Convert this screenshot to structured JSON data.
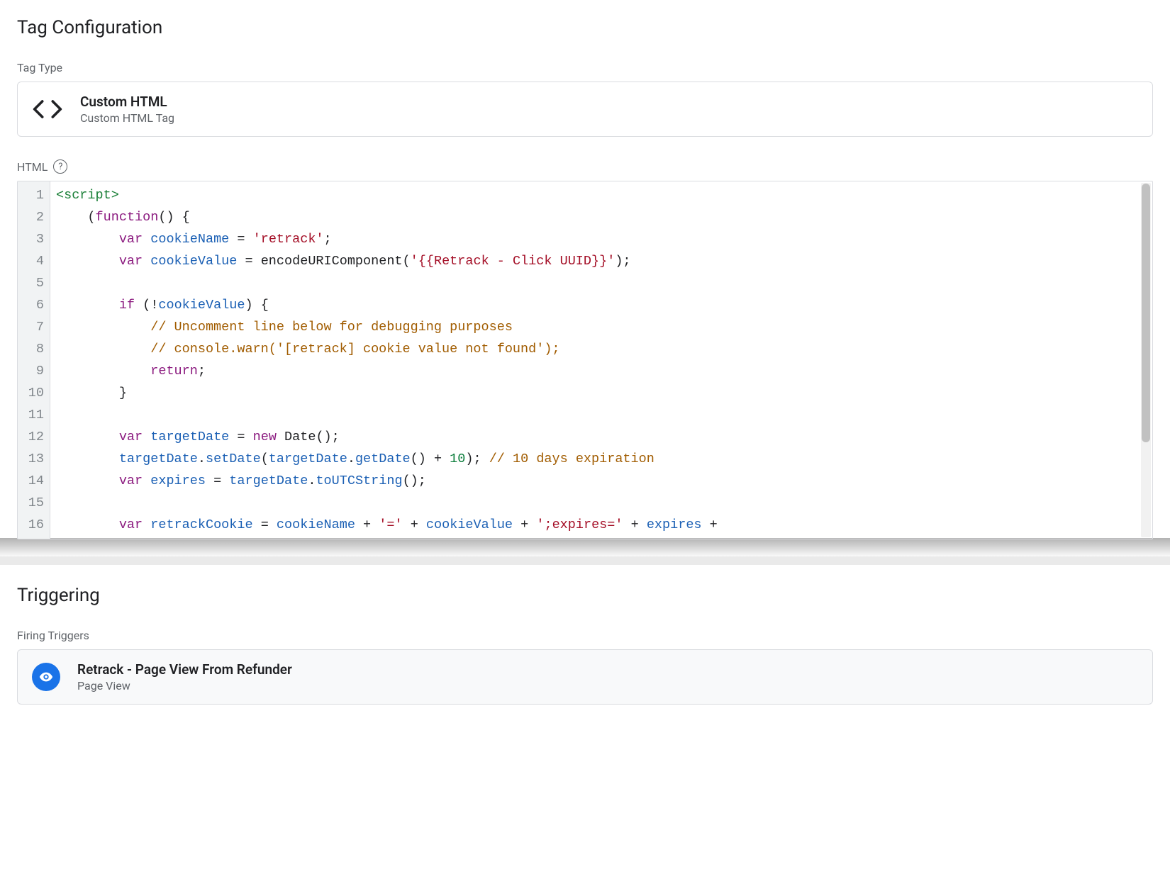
{
  "tagConfig": {
    "heading": "Tag Configuration",
    "tagTypeLabel": "Tag Type",
    "tagType": {
      "title": "Custom HTML",
      "subtitle": "Custom HTML Tag"
    },
    "htmlLabel": "HTML"
  },
  "code": {
    "lineCount": 16,
    "tokens": [
      [
        {
          "t": "tag",
          "v": "<script>"
        }
      ],
      [
        {
          "t": "sp",
          "v": "    "
        },
        {
          "t": "op",
          "v": "("
        },
        {
          "t": "kw",
          "v": "function"
        },
        {
          "t": "op",
          "v": "() {"
        }
      ],
      [
        {
          "t": "sp",
          "v": "        "
        },
        {
          "t": "kw",
          "v": "var"
        },
        {
          "t": "sp",
          "v": " "
        },
        {
          "t": "var",
          "v": "cookieName"
        },
        {
          "t": "sp",
          "v": " "
        },
        {
          "t": "op",
          "v": "="
        },
        {
          "t": "sp",
          "v": " "
        },
        {
          "t": "str",
          "v": "'retrack'"
        },
        {
          "t": "op",
          "v": ";"
        }
      ],
      [
        {
          "t": "sp",
          "v": "        "
        },
        {
          "t": "kw",
          "v": "var"
        },
        {
          "t": "sp",
          "v": " "
        },
        {
          "t": "var",
          "v": "cookieValue"
        },
        {
          "t": "sp",
          "v": " "
        },
        {
          "t": "op",
          "v": "="
        },
        {
          "t": "sp",
          "v": " "
        },
        {
          "t": "id",
          "v": "encodeURIComponent"
        },
        {
          "t": "op",
          "v": "("
        },
        {
          "t": "str",
          "v": "'{{Retrack - Click UUID}}'"
        },
        {
          "t": "op",
          "v": ");"
        }
      ],
      [],
      [
        {
          "t": "sp",
          "v": "        "
        },
        {
          "t": "kw",
          "v": "if"
        },
        {
          "t": "sp",
          "v": " "
        },
        {
          "t": "op",
          "v": "(!"
        },
        {
          "t": "var",
          "v": "cookieValue"
        },
        {
          "t": "op",
          "v": ") {"
        }
      ],
      [
        {
          "t": "sp",
          "v": "            "
        },
        {
          "t": "com",
          "v": "// Uncomment line below for debugging purposes"
        }
      ],
      [
        {
          "t": "sp",
          "v": "            "
        },
        {
          "t": "com",
          "v": "// console.warn('[retrack] cookie value not found');"
        }
      ],
      [
        {
          "t": "sp",
          "v": "            "
        },
        {
          "t": "kw",
          "v": "return"
        },
        {
          "t": "op",
          "v": ";"
        }
      ],
      [
        {
          "t": "sp",
          "v": "        "
        },
        {
          "t": "op",
          "v": "}"
        }
      ],
      [],
      [
        {
          "t": "sp",
          "v": "        "
        },
        {
          "t": "kw",
          "v": "var"
        },
        {
          "t": "sp",
          "v": " "
        },
        {
          "t": "var",
          "v": "targetDate"
        },
        {
          "t": "sp",
          "v": " "
        },
        {
          "t": "op",
          "v": "="
        },
        {
          "t": "sp",
          "v": " "
        },
        {
          "t": "kw",
          "v": "new"
        },
        {
          "t": "sp",
          "v": " "
        },
        {
          "t": "id",
          "v": "Date"
        },
        {
          "t": "op",
          "v": "();"
        }
      ],
      [
        {
          "t": "sp",
          "v": "        "
        },
        {
          "t": "var",
          "v": "targetDate"
        },
        {
          "t": "op",
          "v": "."
        },
        {
          "t": "fn",
          "v": "setDate"
        },
        {
          "t": "op",
          "v": "("
        },
        {
          "t": "var",
          "v": "targetDate"
        },
        {
          "t": "op",
          "v": "."
        },
        {
          "t": "fn",
          "v": "getDate"
        },
        {
          "t": "op",
          "v": "() + "
        },
        {
          "t": "num",
          "v": "10"
        },
        {
          "t": "op",
          "v": "); "
        },
        {
          "t": "com",
          "v": "// 10 days expiration"
        }
      ],
      [
        {
          "t": "sp",
          "v": "        "
        },
        {
          "t": "kw",
          "v": "var"
        },
        {
          "t": "sp",
          "v": " "
        },
        {
          "t": "var",
          "v": "expires"
        },
        {
          "t": "sp",
          "v": " "
        },
        {
          "t": "op",
          "v": "="
        },
        {
          "t": "sp",
          "v": " "
        },
        {
          "t": "var",
          "v": "targetDate"
        },
        {
          "t": "op",
          "v": "."
        },
        {
          "t": "fn",
          "v": "toUTCString"
        },
        {
          "t": "op",
          "v": "();"
        }
      ],
      [],
      [
        {
          "t": "sp",
          "v": "        "
        },
        {
          "t": "kw",
          "v": "var"
        },
        {
          "t": "sp",
          "v": " "
        },
        {
          "t": "var",
          "v": "retrackCookie"
        },
        {
          "t": "sp",
          "v": " "
        },
        {
          "t": "op",
          "v": "="
        },
        {
          "t": "sp",
          "v": " "
        },
        {
          "t": "var",
          "v": "cookieName"
        },
        {
          "t": "sp",
          "v": " "
        },
        {
          "t": "op",
          "v": "+"
        },
        {
          "t": "sp",
          "v": " "
        },
        {
          "t": "str",
          "v": "'='"
        },
        {
          "t": "sp",
          "v": " "
        },
        {
          "t": "op",
          "v": "+"
        },
        {
          "t": "sp",
          "v": " "
        },
        {
          "t": "var",
          "v": "cookieValue"
        },
        {
          "t": "sp",
          "v": " "
        },
        {
          "t": "op",
          "v": "+"
        },
        {
          "t": "sp",
          "v": " "
        },
        {
          "t": "str",
          "v": "';expires='"
        },
        {
          "t": "sp",
          "v": " "
        },
        {
          "t": "op",
          "v": "+"
        },
        {
          "t": "sp",
          "v": " "
        },
        {
          "t": "var",
          "v": "expires"
        },
        {
          "t": "sp",
          "v": " "
        },
        {
          "t": "op",
          "v": "+"
        }
      ]
    ]
  },
  "triggering": {
    "heading": "Triggering",
    "firingLabel": "Firing Triggers",
    "trigger": {
      "title": "Retrack - Page View From Refunder",
      "subtitle": "Page View"
    }
  }
}
